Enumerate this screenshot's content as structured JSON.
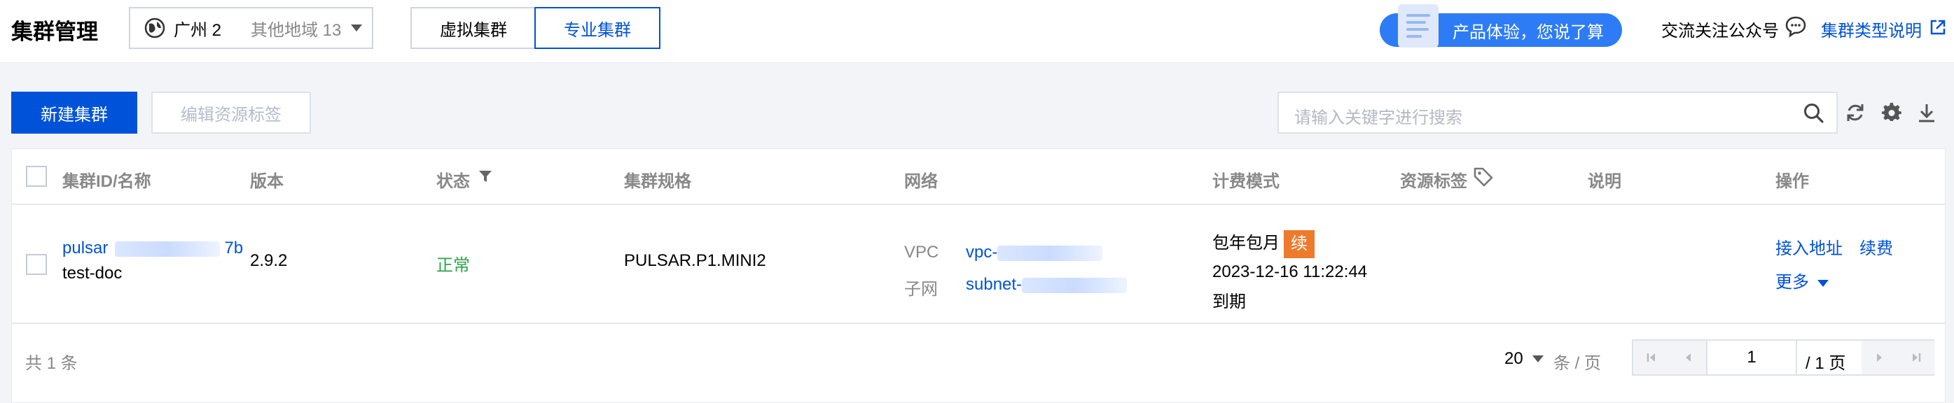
{
  "header": {
    "title": "集群管理",
    "region_current": "广州 2",
    "region_other": "其他地域 13",
    "tabs": [
      "虚拟集群",
      "专业集群"
    ],
    "feedback": "产品体验，您说了算",
    "follow": "交流关注公众号",
    "help": "集群类型说明"
  },
  "toolbar": {
    "create": "新建集群",
    "edit_tags": "编辑资源标签",
    "search_placeholder": "请输入关键字进行搜索"
  },
  "table": {
    "columns": [
      "集群ID/名称",
      "版本",
      "状态",
      "集群规格",
      "网络",
      "计费模式",
      "资源标签",
      "说明",
      "操作"
    ],
    "rows": [
      {
        "id_prefix": "pulsar",
        "id_suffix": "7b",
        "name": "test-doc",
        "version": "2.9.2",
        "status": "正常",
        "spec": "PULSAR.P1.MINI2",
        "vpc_label": "VPC",
        "vpc_value": "vpc-",
        "subnet_label": "子网",
        "subnet_value": "subnet-",
        "billing": "包年包月",
        "renew_badge": "续",
        "expire_time": "2023-12-16 11:22:44",
        "expire_suffix": "到期",
        "actions": [
          "接入地址",
          "续费",
          "更多"
        ]
      }
    ]
  },
  "footer": {
    "total": "共 1 条",
    "page_size": "20",
    "per_page": "条 / 页",
    "current_page": "1",
    "total_pages": "/ 1 页"
  },
  "colors": {
    "primary": "#0052d9",
    "success": "#29a546",
    "renew": "#ee7a2b",
    "feedback": "#2d7cf6"
  }
}
